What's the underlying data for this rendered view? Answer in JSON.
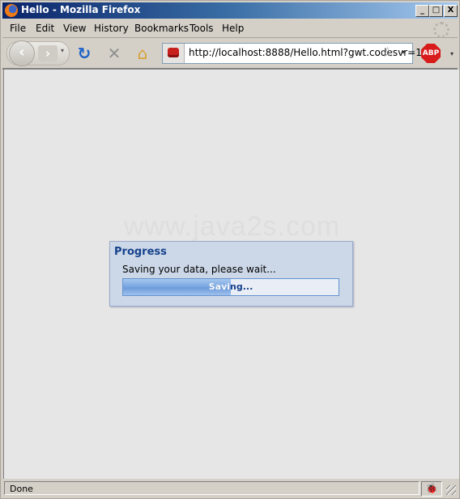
{
  "window": {
    "title": "Hello - Mozilla Firefox",
    "controls": {
      "minimize": "_",
      "maximize": "□",
      "close": "X"
    }
  },
  "menubar": {
    "items": [
      {
        "label": "File",
        "accel": "F"
      },
      {
        "label": "Edit",
        "accel": "E"
      },
      {
        "label": "View",
        "accel": "V"
      },
      {
        "label": "History",
        "accel": "s"
      },
      {
        "label": "Bookmarks",
        "accel": "B"
      },
      {
        "label": "Tools",
        "accel": "T"
      },
      {
        "label": "Help",
        "accel": "H"
      }
    ]
  },
  "toolbar": {
    "back_icon": "‹",
    "forward_icon": "›",
    "reload_icon": "↻",
    "stop_icon": "✕",
    "home_icon": "⌂",
    "url": "http://localhost:8888/Hello.html?gwt.codesvr=1",
    "bookmark_star_icon": "☆",
    "dropdown_icon": "▾",
    "abp_label": "ABP"
  },
  "page": {
    "watermark": "www.java2s.com",
    "dialog": {
      "title": "Progress",
      "message": "Saving your data, please wait...",
      "progress_text": "Saving...",
      "progress_fraction": 0.5
    }
  },
  "statusbar": {
    "text": "Done",
    "bug_icon": "🐞"
  }
}
